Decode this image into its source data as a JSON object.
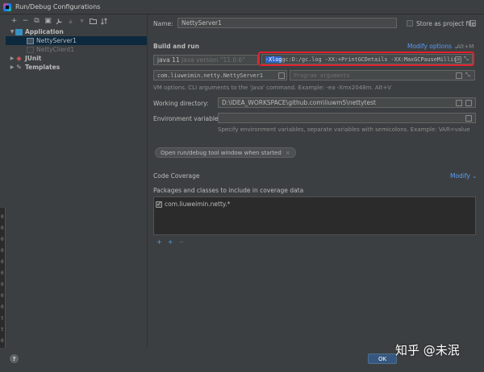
{
  "window": {
    "title": "Run/Debug Configurations"
  },
  "toolbar": {
    "add": "+",
    "remove": "−",
    "copy": "⧉",
    "save": "▣",
    "settings": "🔧",
    "up": "▲",
    "down": "▼",
    "sort": "⇅",
    "folder": "▭"
  },
  "tree": {
    "application": "Application",
    "netty_server": "NettyServer1",
    "netty_client": "NettyClient1",
    "junit": "JUnit",
    "templates": "Templates"
  },
  "form": {
    "name_label": "Name:",
    "name_value": "NettyServer1",
    "store_label": "Store as project file",
    "build_run_label": "Build and run",
    "modify_options": "Modify options",
    "modify_shortcut": "Alt+M",
    "jre_value": "java 11",
    "jre_version": "java version \"11.0.6\"",
    "vm_selected": "-Xlog",
    "vm_rest": "gc:D:/gc.log -XX:+PrintGCDetails -XX:MaxGCPauseMillis=",
    "main_class": "com.liuweimin.netty.NettyServer1",
    "program_args_placeholder": "Program arguments",
    "vm_hint": "VM options. CLI arguments to the 'java' command. Example: -ea -Xmx2048m. Alt+V",
    "workdir_label": "Working directory:",
    "workdir_value": "D:\\IDEA_WORKSPACE\\github.com\\liuwm5\\nettytest",
    "env_label": "Environment variables:",
    "env_hint": "Specify environment variables, separate variables with semicolons. Example: VAR=value",
    "chip_label": "Open run/debug tool window when started",
    "chip_close": "×"
  },
  "coverage": {
    "title": "Code Coverage",
    "modify": "Modify",
    "packages_label": "Packages and classes to include in coverage data",
    "entry": "com.liuweimin.netty.*",
    "add_class": "+",
    "add_package": "+",
    "remove": "−"
  },
  "bottom": {
    "help": "?",
    "ok": "OK"
  },
  "watermark": "知乎 @未泯",
  "outer_strip_chars": [
    "0",
    "0",
    "0",
    "0",
    "0",
    "0",
    "0",
    "0",
    "0",
    "t",
    "t",
    "0"
  ],
  "colors": {
    "link": "#589df6",
    "highlight": "#e2212d",
    "selection": "#2f65ca",
    "ok_button": "#365880"
  }
}
